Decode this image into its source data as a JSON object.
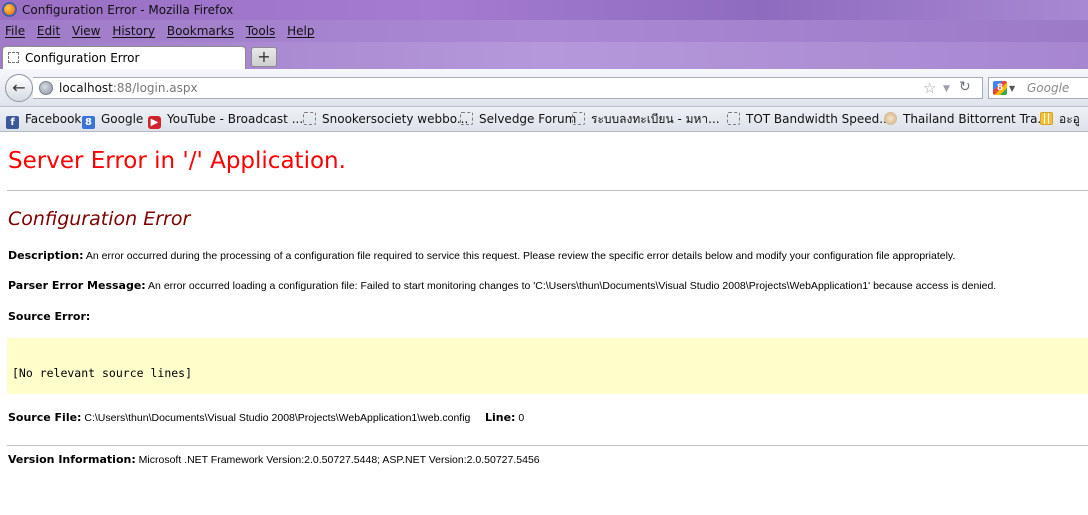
{
  "window": {
    "title": "Configuration Error - Mozilla Firefox"
  },
  "menubar": {
    "items": [
      "File",
      "Edit",
      "View",
      "History",
      "Bookmarks",
      "Tools",
      "Help"
    ]
  },
  "tabs": [
    {
      "label": "Configuration Error",
      "active": true
    }
  ],
  "newtab_label": "+",
  "navbar": {
    "url_host": "localhost",
    "url_rest": ":88/login.aspx",
    "search_placeholder": "Google"
  },
  "bookmarks": [
    {
      "label": "Facebook",
      "icon": "facebook-icon"
    },
    {
      "label": "Google",
      "icon": "google-icon"
    },
    {
      "label": "YouTube - Broadcast ...",
      "icon": "youtube-icon"
    },
    {
      "label": "Snookersociety webbo...",
      "icon": "blank-page-icon"
    },
    {
      "label": "Selvedge Forum",
      "icon": "blank-page-icon"
    },
    {
      "label": "ระบบลงทะเบียน - มหา...",
      "icon": "blank-page-icon"
    },
    {
      "label": "TOT Bandwidth Speed...",
      "icon": "blank-page-icon"
    },
    {
      "label": "Thailand Bittorrent Tra...",
      "icon": "bittorrent-icon"
    },
    {
      "label": "อะอู",
      "icon": "grid-icon"
    }
  ],
  "page": {
    "server_error": "Server Error in '/' Application.",
    "error_title": "Configuration Error",
    "description_label": "Description:",
    "description_text": " An error occurred during the processing of a configuration file required to service this request. Please review the specific error details below and modify your configuration file appropriately.",
    "parser_label": "Parser Error Message:",
    "parser_text": " An error occurred loading a configuration file: Failed to start monitoring changes to 'C:\\Users\\thun\\Documents\\Visual Studio 2008\\Projects\\WebApplication1' because access is denied.",
    "source_error_label": "Source Error:",
    "source_lines": "[No relevant source lines]",
    "source_file_label": "Source File:",
    "source_file_text": " C:\\Users\\thun\\Documents\\Visual Studio 2008\\Projects\\WebApplication1\\web.config",
    "line_label": "Line:",
    "line_value": " 0",
    "version_label": "Version Information:",
    "version_text": " Microsoft .NET Framework Version:2.0.50727.5448; ASP.NET Version:2.0.50727.5456"
  },
  "colors": {
    "server_error": "#ff0000",
    "error_title": "#800000",
    "source_box": "#ffffcc"
  }
}
